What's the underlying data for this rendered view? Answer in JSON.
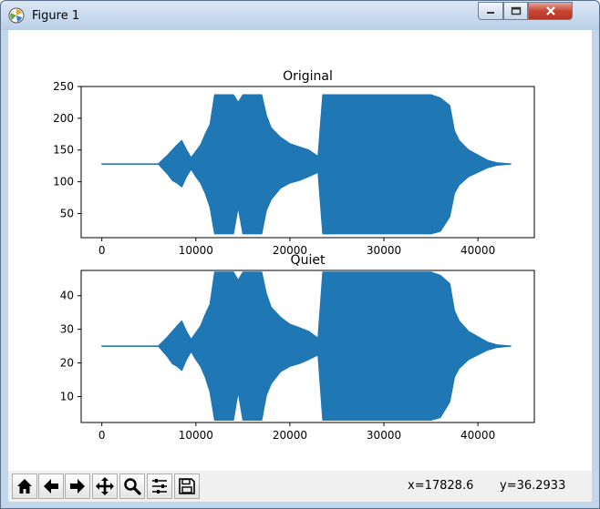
{
  "window": {
    "title": "Figure 1",
    "icons": {
      "app": "matplotlib-figure-icon",
      "minimize": "minimize-icon",
      "maximize": "maximize-icon",
      "close": "close-icon"
    }
  },
  "colors": {
    "line": "#1f77b4",
    "toolbar_bg": "#f0f0f0",
    "titlebar": "#c4d6eb",
    "close": "#c64633"
  },
  "toolbar": {
    "buttons": [
      {
        "name": "home-button",
        "icon": "home-icon"
      },
      {
        "name": "back-button",
        "icon": "arrow-left-icon"
      },
      {
        "name": "forward-button",
        "icon": "arrow-right-icon"
      },
      {
        "name": "pan-button",
        "icon": "move-arrows-icon"
      },
      {
        "name": "zoom-button",
        "icon": "magnifier-icon"
      },
      {
        "name": "configure-subplots-button",
        "icon": "sliders-icon"
      },
      {
        "name": "save-button",
        "icon": "floppy-disk-icon"
      }
    ],
    "coord_x": "x=17828.6",
    "coord_y": "y=36.2933"
  },
  "chart_data": [
    {
      "type": "line",
      "title": "Original",
      "xlabel": "",
      "ylabel": "",
      "xlim": [
        -2200,
        46000
      ],
      "ylim": [
        12,
        250
      ],
      "xticks": [
        0,
        10000,
        20000,
        30000,
        40000
      ],
      "xtick_labels": [
        "0",
        "10000",
        "20000",
        "30000",
        "40000"
      ],
      "yticks": [
        50,
        100,
        150,
        200,
        250
      ],
      "ytick_labels": [
        "50",
        "100",
        "150",
        "200",
        "250"
      ],
      "grid": false,
      "series": [
        {
          "x": [
            0,
            6000,
            6500,
            7000,
            7500,
            8000,
            8500,
            9000,
            9500,
            10000,
            10500,
            11000,
            11500,
            12000,
            13000,
            13500,
            14000,
            14500,
            15000,
            16000,
            17000,
            17500,
            18000,
            19000,
            20000,
            21000,
            22000,
            23000,
            23500,
            24000,
            25000,
            26000,
            27000,
            28000,
            29000,
            30000,
            31000,
            32000,
            33000,
            34000,
            35000,
            36000,
            37000,
            37500,
            38000,
            39000,
            40000,
            41000,
            42000,
            43500
          ],
          "upper": [
            128,
            128,
            135,
            142,
            150,
            158,
            165,
            150,
            138,
            148,
            158,
            175,
            190,
            237,
            237,
            237,
            237,
            225,
            237,
            237,
            237,
            205,
            185,
            170,
            160,
            155,
            150,
            140,
            237,
            237,
            237,
            237,
            237,
            237,
            237,
            237,
            237,
            237,
            237,
            237,
            237,
            232,
            220,
            180,
            165,
            150,
            142,
            134,
            130,
            128
          ],
          "lower": [
            128,
            128,
            120,
            112,
            102,
            98,
            92,
            108,
            120,
            108,
            98,
            82,
            60,
            18,
            18,
            18,
            18,
            60,
            18,
            18,
            18,
            55,
            72,
            90,
            98,
            102,
            108,
            115,
            18,
            18,
            18,
            18,
            18,
            18,
            18,
            18,
            18,
            18,
            18,
            18,
            18,
            22,
            45,
            82,
            95,
            108,
            115,
            122,
            126,
            128
          ]
        }
      ]
    },
    {
      "type": "line",
      "title": "Quiet",
      "xlabel": "",
      "ylabel": "",
      "xlim": [
        -2200,
        46000
      ],
      "ylim": [
        2.3,
        47.5
      ],
      "xticks": [
        0,
        10000,
        20000,
        30000,
        40000
      ],
      "xtick_labels": [
        "0",
        "10000",
        "20000",
        "30000",
        "40000"
      ],
      "yticks": [
        10,
        20,
        30,
        40
      ],
      "ytick_labels": [
        "10",
        "20",
        "30",
        "40"
      ],
      "grid": false,
      "series": [
        {
          "x": [
            0,
            6000,
            6500,
            7000,
            7500,
            8000,
            8500,
            9000,
            9500,
            10000,
            10500,
            11000,
            11500,
            12000,
            13000,
            13500,
            14000,
            14500,
            15000,
            16000,
            17000,
            17500,
            18000,
            19000,
            20000,
            21000,
            22000,
            23000,
            23500,
            24000,
            25000,
            26000,
            27000,
            28000,
            29000,
            30000,
            31000,
            32000,
            33000,
            34000,
            35000,
            36000,
            37000,
            37500,
            38000,
            39000,
            40000,
            41000,
            42000,
            43500
          ],
          "upper": [
            25,
            25,
            26.4,
            27.8,
            29.4,
            31,
            32.5,
            29.4,
            27,
            29,
            31,
            34.4,
            37.4,
            47,
            47,
            47,
            47,
            44.6,
            47,
            47,
            47,
            40.6,
            36.6,
            33.6,
            31.5,
            30.5,
            29.4,
            27.4,
            47,
            47,
            47,
            47,
            47,
            47,
            47,
            47,
            47,
            47,
            47,
            47,
            47,
            46,
            43.6,
            35.5,
            32.5,
            29.4,
            27.8,
            26.2,
            25.4,
            25
          ],
          "lower": [
            25,
            25,
            23.4,
            21.8,
            19.8,
            19,
            17.8,
            21,
            23.4,
            21,
            19,
            15.8,
            11.4,
            3,
            3,
            3,
            3,
            11.4,
            3,
            3,
            3,
            10.4,
            13.8,
            17.4,
            19,
            19.8,
            21,
            22.4,
            3,
            3,
            3,
            3,
            3,
            3,
            3,
            3,
            3,
            3,
            3,
            3,
            3,
            3.8,
            8.4,
            15.8,
            18.4,
            21,
            22.4,
            23.8,
            24.6,
            25
          ]
        }
      ]
    }
  ]
}
